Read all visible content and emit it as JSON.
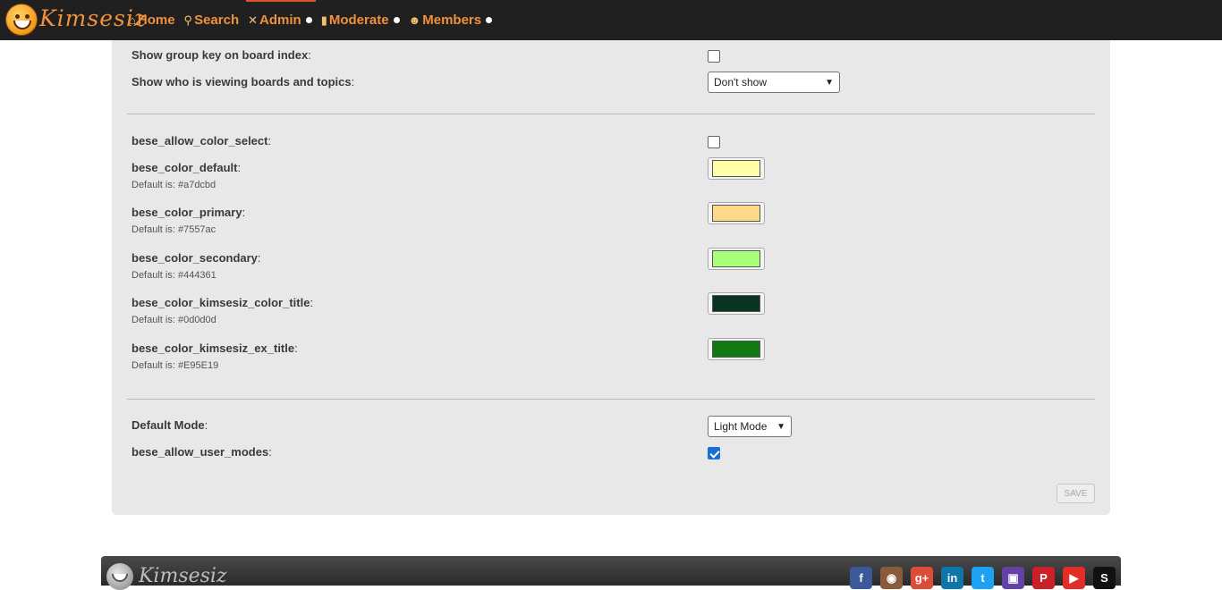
{
  "brand": {
    "name": "Kimsesiz"
  },
  "nav": {
    "items": [
      {
        "label": "Home",
        "icon": "home-icon"
      },
      {
        "label": "Search",
        "icon": "search-icon"
      },
      {
        "label": "Admin",
        "icon": "tools-icon"
      },
      {
        "label": "Moderate",
        "icon": "traffic-light-icon"
      },
      {
        "label": "Members",
        "icon": "members-icon"
      }
    ]
  },
  "settings": {
    "group_key": {
      "label": "Show group key on board index",
      "checked": false
    },
    "who_viewing": {
      "label": "Show who is viewing boards and topics",
      "value": "Don't show"
    },
    "allow_color_select": {
      "label": "bese_allow_color_select",
      "checked": false
    },
    "color_default": {
      "label": "bese_color_default",
      "hint": "Default is: #a7dcbd",
      "color": "#ffffa8"
    },
    "color_primary": {
      "label": "bese_color_primary",
      "hint": "Default is: #7557ac",
      "color": "#ffd98a"
    },
    "color_secondary": {
      "label": "bese_color_secondary",
      "hint": "Default is: #444361",
      "color": "#a8ff78"
    },
    "color_title": {
      "label": "bese_color_kimsesiz_color_title",
      "hint": "Default is: #0d0d0d",
      "color": "#0a3322"
    },
    "color_ex_title": {
      "label": "bese_color_kimsesiz_ex_title",
      "hint": "Default is: #E95E19",
      "color": "#127a12"
    },
    "default_mode": {
      "label": "Default Mode",
      "value": "Light Mode"
    },
    "allow_user_modes": {
      "label": "bese_allow_user_modes",
      "checked": true
    },
    "save_label": "SAVE"
  },
  "footer": {
    "brand": "Kimsesiz"
  },
  "socials": [
    {
      "name": "facebook-icon",
      "glyph": "f",
      "color": "#3b5998"
    },
    {
      "name": "instagram-icon",
      "glyph": "◉",
      "color": "#8a5a3c"
    },
    {
      "name": "google-plus-icon",
      "glyph": "g+",
      "color": "#dd4b39"
    },
    {
      "name": "linkedin-icon",
      "glyph": "in",
      "color": "#0e76a8"
    },
    {
      "name": "twitter-icon",
      "glyph": "t",
      "color": "#1da1f2"
    },
    {
      "name": "twitch-icon",
      "glyph": "▣",
      "color": "#6441a5"
    },
    {
      "name": "pinterest-icon",
      "glyph": "P",
      "color": "#cb2027"
    },
    {
      "name": "youtube-icon",
      "glyph": "▶",
      "color": "#e52d27"
    },
    {
      "name": "steam-icon",
      "glyph": "S",
      "color": "#111111"
    }
  ]
}
